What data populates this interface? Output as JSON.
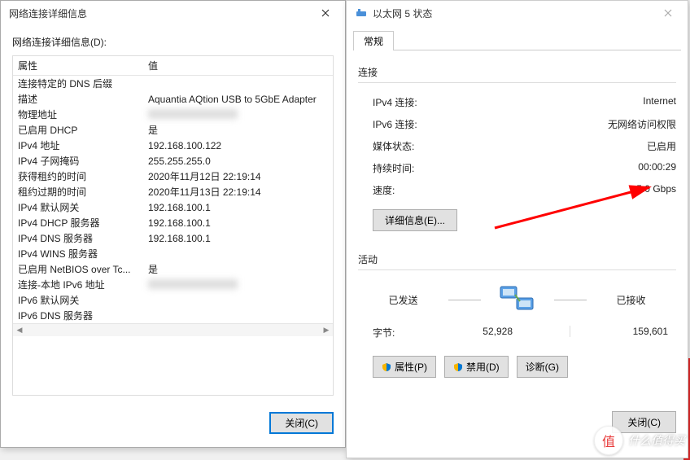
{
  "left": {
    "title": "网络连接详细信息",
    "section_label": "网络连接详细信息(D):",
    "col_prop": "属性",
    "col_val": "值",
    "rows": [
      {
        "prop": "连接特定的 DNS 后缀",
        "val": ""
      },
      {
        "prop": "描述",
        "val": "Aquantia AQtion USB to 5GbE Adapter"
      },
      {
        "prop": "物理地址",
        "val": "",
        "redacted": true
      },
      {
        "prop": "已启用 DHCP",
        "val": "是"
      },
      {
        "prop": "IPv4 地址",
        "val": "192.168.100.122"
      },
      {
        "prop": "IPv4 子网掩码",
        "val": "255.255.255.0"
      },
      {
        "prop": "获得租约的时间",
        "val": "2020年11月12日 22:19:14"
      },
      {
        "prop": "租约过期的时间",
        "val": "2020年11月13日 22:19:14"
      },
      {
        "prop": "IPv4 默认网关",
        "val": "192.168.100.1"
      },
      {
        "prop": "IPv4 DHCP 服务器",
        "val": "192.168.100.1"
      },
      {
        "prop": "IPv4 DNS 服务器",
        "val": "192.168.100.1"
      },
      {
        "prop": "IPv4 WINS 服务器",
        "val": ""
      },
      {
        "prop": "已启用 NetBIOS over Tc...",
        "val": "是"
      },
      {
        "prop": "连接-本地 IPv6 地址",
        "val": "",
        "redacted": true
      },
      {
        "prop": "IPv6 默认网关",
        "val": ""
      },
      {
        "prop": "IPv6 DNS 服务器",
        "val": ""
      }
    ],
    "close_btn": "关闭(C)"
  },
  "right": {
    "title": "以太网 5 状态",
    "tab": "常规",
    "conn_title": "连接",
    "conn": [
      {
        "k": "IPv4 连接:",
        "v": "Internet"
      },
      {
        "k": "IPv6 连接:",
        "v": "无网络访问权限"
      },
      {
        "k": "媒体状态:",
        "v": "已启用"
      },
      {
        "k": "持续时间:",
        "v": "00:00:29"
      },
      {
        "k": "速度:",
        "v": "5.0 Gbps"
      }
    ],
    "detail_btn": "详细信息(E)...",
    "activity_title": "活动",
    "sent": "已发送",
    "recv": "已接收",
    "bytes_label": "字节:",
    "bytes_sent": "52,928",
    "bytes_recv": "159,601",
    "btn_prop": "属性(P)",
    "btn_disable": "禁用(D)",
    "btn_diag": "诊断(G)",
    "close_btn": "关闭(C)"
  },
  "watermark": {
    "logo": "值",
    "text": "什么值得买"
  }
}
